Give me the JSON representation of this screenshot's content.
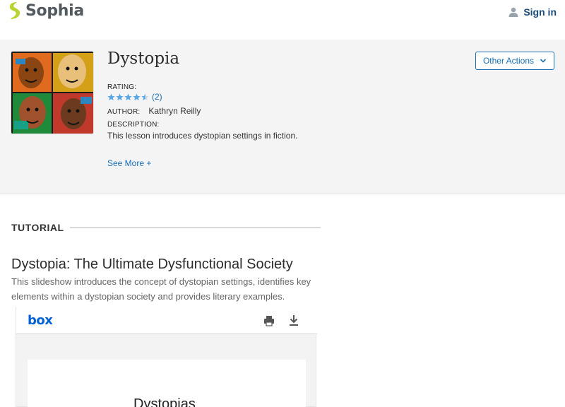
{
  "topbar": {
    "brand": "Sophia",
    "signin_label": "Sign in"
  },
  "lesson": {
    "title": "Dystopia",
    "rating_label": "RATING:",
    "rating_value": 4.5,
    "rating_count": "(2)",
    "author_label": "AUTHOR:",
    "author_name": "Kathryn Reilly",
    "description_label": "DESCRIPTION:",
    "description": "This lesson introduces dystopian settings in fiction.",
    "see_more_label": "See More +",
    "other_actions_label": "Other Actions"
  },
  "tutorial": {
    "section_label": "TUTORIAL",
    "title": "Dystopia: The Ultimate Dysfunctional Society",
    "description": "This slideshow introduces the concept of dystopian settings, identifies key elements within a dystopian society and provides literary examples."
  },
  "viewer": {
    "brand": "box",
    "slide_title": "Dystopias"
  },
  "colors": {
    "brand_green": "#b8d432",
    "link_blue": "#1a6fb5",
    "star_blue": "#5aa9e6",
    "box_blue": "#0061d5"
  },
  "icons": [
    "sophia-logo-icon",
    "user-icon",
    "star-icon",
    "chevron-down-icon",
    "print-icon",
    "download-icon"
  ]
}
